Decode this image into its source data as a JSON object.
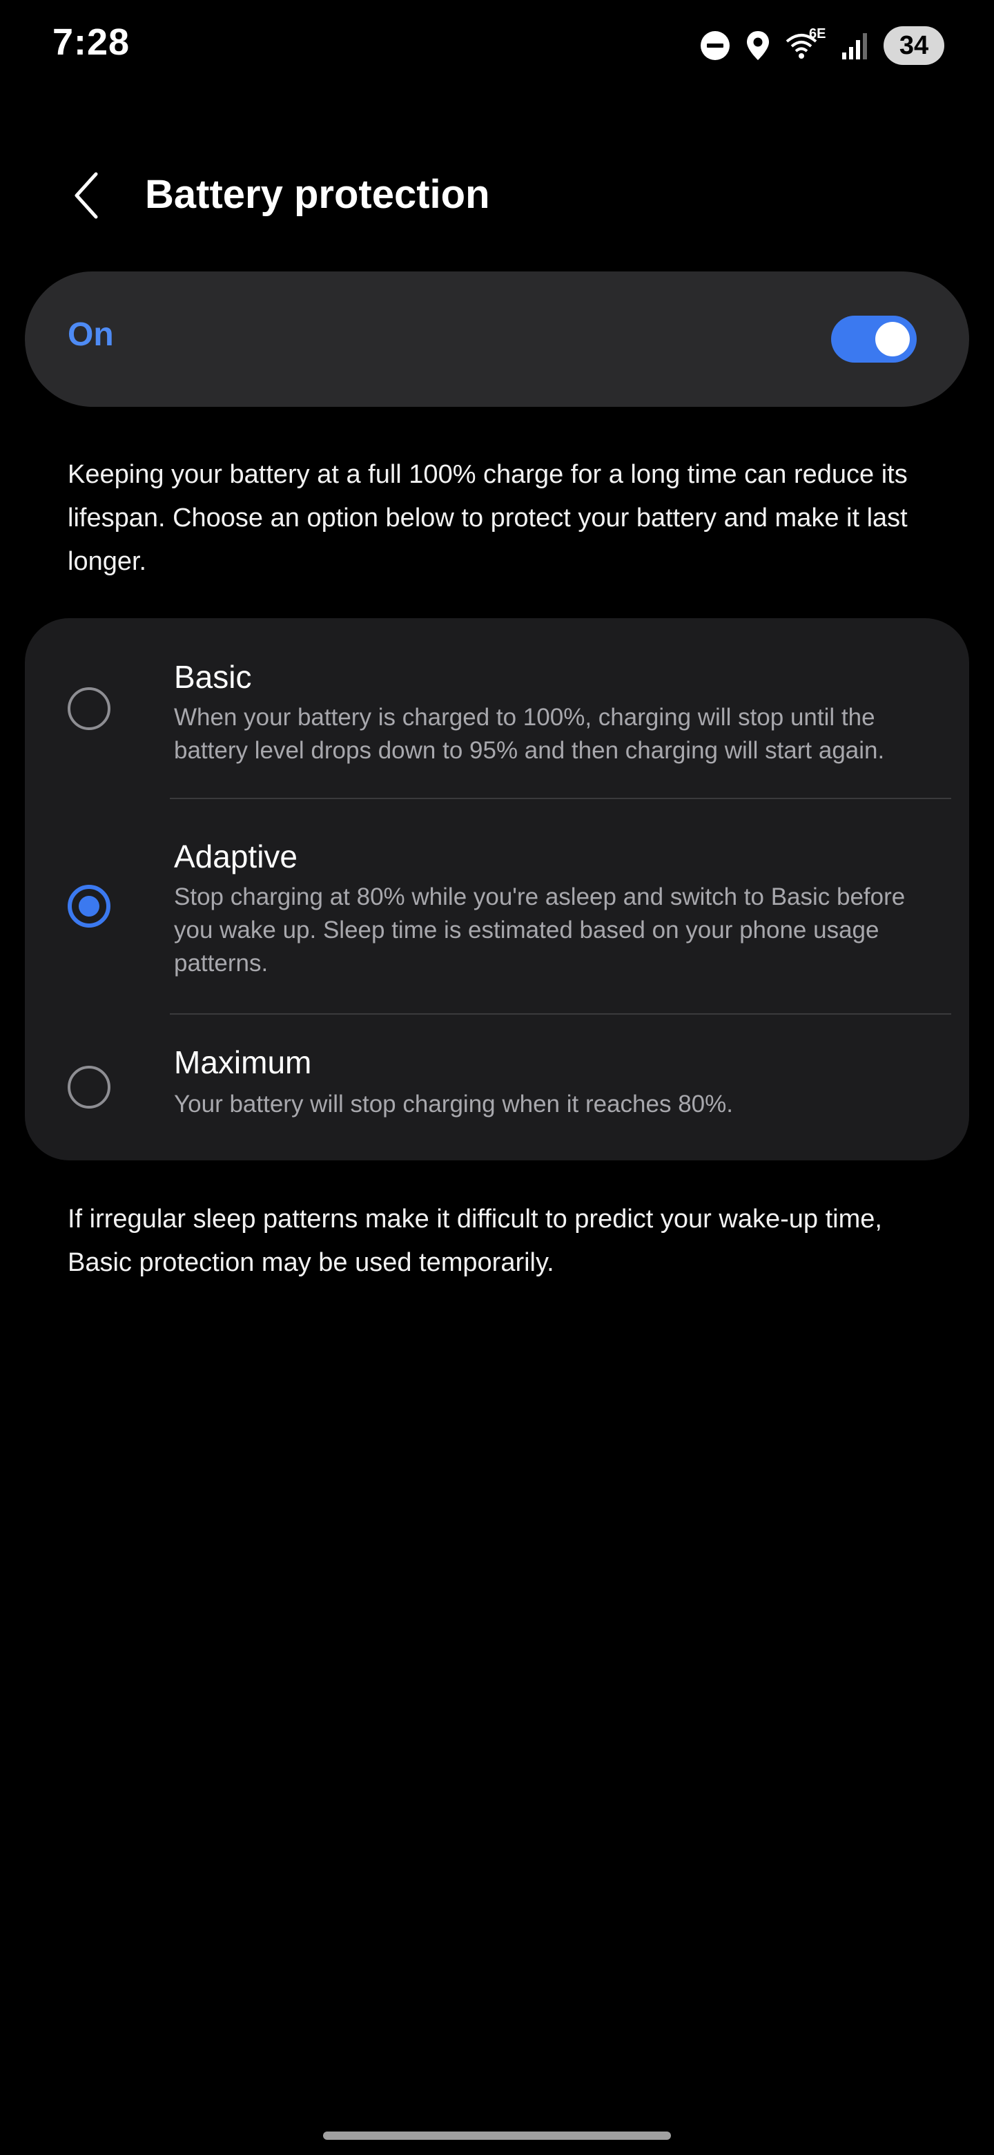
{
  "status_bar": {
    "time": "7:28",
    "battery_level": "34",
    "wifi_label": "6E",
    "icons": [
      "do-not-disturb-icon",
      "location-icon",
      "wifi-6e-icon",
      "cellular-signal-icon",
      "battery-icon"
    ]
  },
  "header": {
    "back_icon": "chevron-left-icon",
    "title": "Battery protection"
  },
  "master_toggle": {
    "label": "On",
    "state": "on",
    "accent_color": "#3b79f0"
  },
  "description": "Keeping your battery at a full 100% charge for a long time can reduce its lifespan. Choose an option below to protect your battery and make it last longer.",
  "options": [
    {
      "title": "Basic",
      "description": "When your battery is charged to 100%, charging will stop until the battery level drops down to 95% and then charging will start again.",
      "selected": false
    },
    {
      "title": "Adaptive",
      "description": "Stop charging at 80% while you're asleep and switch to Basic before you wake up. Sleep time is estimated based on your phone usage patterns.",
      "selected": true
    },
    {
      "title": "Maximum",
      "description": "Your battery will stop charging when it reaches 80%.",
      "selected": false
    }
  ],
  "footnote": "If irregular sleep patterns make it difficult to predict your wake-up time, Basic protection may be used temporarily."
}
